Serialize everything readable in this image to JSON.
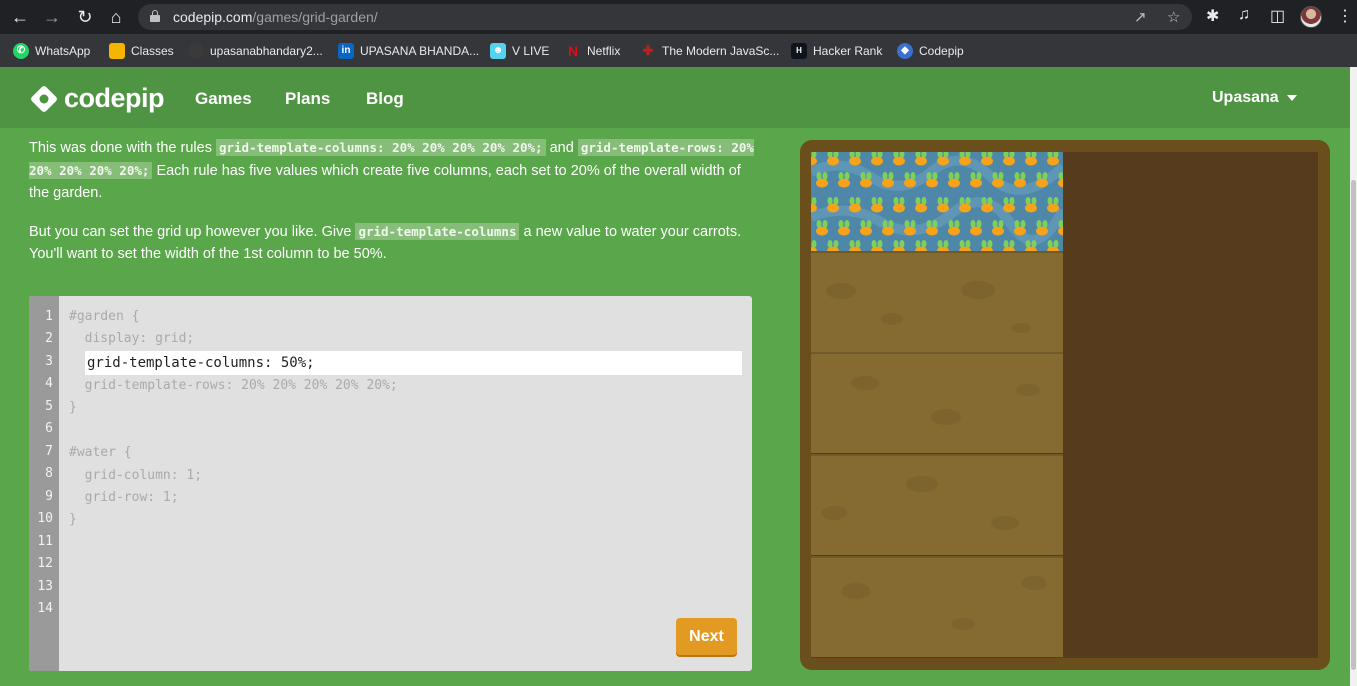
{
  "browser": {
    "url_host": "codepip.com",
    "url_path": "/games/grid-garden/",
    "bookmarks": [
      {
        "label": "WhatsApp",
        "icon": "whatsapp-icon",
        "color": "#25d366"
      },
      {
        "label": "Classes",
        "icon": "classroom-icon",
        "color": "#f5b400"
      },
      {
        "label": "upasanabhandary2...",
        "icon": "github-icon",
        "color": "#3a3a3a"
      },
      {
        "label": "UPASANA BHANDA...",
        "icon": "linkedin-icon",
        "color": "#0a66c2"
      },
      {
        "label": "V LIVE",
        "icon": "vlive-icon",
        "color": "#54d2f0"
      },
      {
        "label": "Netflix",
        "icon": "netflix-icon",
        "color": "#e50914"
      },
      {
        "label": "The Modern JavaSc...",
        "icon": "javascript-info-icon",
        "color": "#c01f1f"
      },
      {
        "label": "Hacker Rank",
        "icon": "hackerrank-icon",
        "color": "#1ba94c"
      },
      {
        "label": "Codepip",
        "icon": "codepip-icon",
        "color": "#3b6fd1"
      }
    ]
  },
  "header": {
    "logo_text": "codepip",
    "nav": [
      "Games",
      "Plans",
      "Blog"
    ],
    "user": "Upasana"
  },
  "instructions": {
    "p1_a": "This was done with the rules ",
    "p1_code1": "grid-template-columns: 20% 20% 20% 20% 20%;",
    "p1_b": " and ",
    "p1_code2": "grid-template-rows: 20% 20% 20% 20% 20%;",
    "p1_c": " Each rule has five values which create five columns, each set to 20% of the overall width of the garden.",
    "p2_a": "But you can set the grid up however you like. Give ",
    "p2_code": "grid-template-columns",
    "p2_b": " a new value to water your carrots. You'll want to set the width of the 1st column to be 50%."
  },
  "editor": {
    "line_numbers": [
      "1",
      "2",
      "3",
      "4",
      "5",
      "6",
      "7",
      "8",
      "9",
      "10",
      "11",
      "12",
      "13",
      "14"
    ],
    "lines": {
      "l1": "#garden {",
      "l2": "  display: grid;",
      "l4": "  grid-template-rows: 20% 20% 20% 20% 20%;",
      "l5": "}",
      "l7": "#water {",
      "l8": "  grid-column: 1;",
      "l9": "  grid-row: 1;",
      "l10": "}"
    },
    "input_value": "grid-template-columns: 50%;",
    "next_label": "Next"
  },
  "colors": {
    "page_bg": "#5aa64b",
    "header_bg": "#4e9443",
    "next_button": "#e39a22",
    "water": "#4e87a8",
    "soil": "#856b32"
  }
}
